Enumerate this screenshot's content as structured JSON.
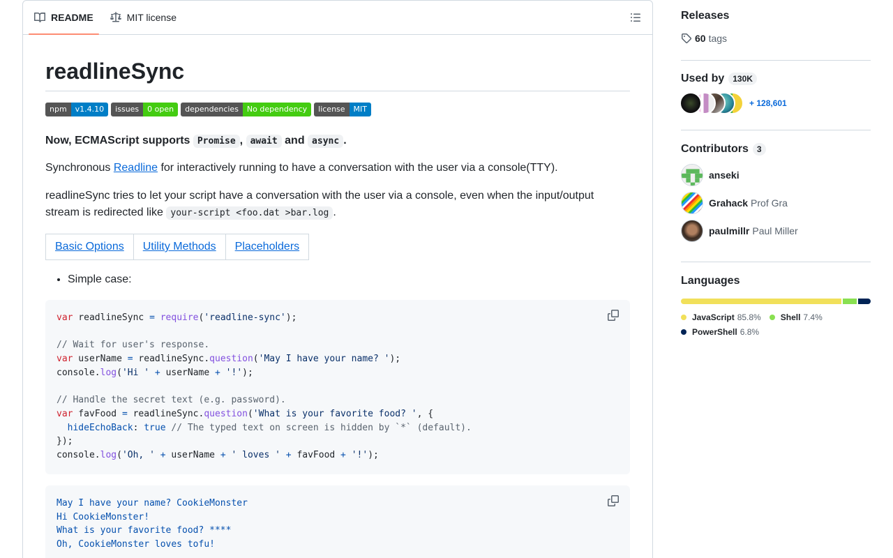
{
  "tabs": {
    "readme": "README",
    "license": "MIT license"
  },
  "readme": {
    "title": "readlineSync",
    "badges": [
      {
        "label": "npm",
        "value": "v1.4.10",
        "color": "#007ec6"
      },
      {
        "label": "issues",
        "value": "0 open",
        "color": "#4c1"
      },
      {
        "label": "dependencies",
        "value": "No dependency",
        "color": "#4c1"
      },
      {
        "label": "license",
        "value": "MIT",
        "color": "#007ec6"
      }
    ],
    "intro": {
      "prefix": "Now, ECMAScript supports ",
      "promise": "Promise",
      "comma": ",",
      "await": "await",
      "and": " and ",
      "async": "async",
      "period": "."
    },
    "p1": {
      "before": "Synchronous ",
      "link": "Readline",
      "after": " for interactively running to have a conversation with the user via a console(TTY)."
    },
    "p2": {
      "before": "readlineSync tries to let your script have a conversation with the user via a console, even when the input/output stream is redirected like ",
      "code": "your-script <foo.dat >bar.log",
      "after": "."
    },
    "nav_links": [
      "Basic Options",
      "Utility Methods",
      "Placeholders"
    ],
    "list_item": "Simple case:",
    "code1": {
      "l1": {
        "kw": "var",
        "a": " readlineSync ",
        "op": "=",
        "sp": " ",
        "fn": "require",
        "p1": "(",
        "str": "'readline-sync'",
        "p2": ");"
      },
      "l3": "// Wait for user's response.",
      "l4": {
        "kw": "var",
        "a": " userName ",
        "op": "=",
        "b": " readlineSync.",
        "fn": "question",
        "p1": "(",
        "str": "'May I have your name? '",
        "p2": ");"
      },
      "l5": {
        "a": "console.",
        "fn": "log",
        "p1": "(",
        "s1": "'Hi '",
        "op1": " + ",
        "v": "userName",
        "op2": " + ",
        "s2": "'!'",
        "p2": ");"
      },
      "l7": "// Handle the secret text (e.g. password).",
      "l8": {
        "kw": "var",
        "a": " favFood ",
        "op": "=",
        "b": " readlineSync.",
        "fn": "question",
        "p1": "(",
        "str": "'What is your favorite food? '",
        "p2": ", {"
      },
      "l9": {
        "ind": "  ",
        "prop": "hideEchoBack",
        "col": ": ",
        "val": "true",
        "cm": " // The typed text on screen is hidden by `*` (default)."
      },
      "l10": "});",
      "l11": {
        "a": "console.",
        "fn": "log",
        "p1": "(",
        "s1": "'Oh, '",
        "op1": " + ",
        "v1": "userName",
        "op2": " + ",
        "s2": "' loves '",
        "op3": " + ",
        "v2": "favFood",
        "op4": " + ",
        "s3": "'!'",
        "p2": ");"
      }
    },
    "code2": [
      "May I have your name? CookieMonster",
      "Hi CookieMonster!",
      "What is your favorite food? ****",
      "Oh, CookieMonster loves tofu!"
    ]
  },
  "sidebar": {
    "releases": {
      "title": "Releases",
      "tag_count": "60",
      "tag_label": "tags"
    },
    "used_by": {
      "title": "Used by",
      "count": "130K",
      "more": "+ 128,601"
    },
    "contributors": {
      "title": "Contributors",
      "count": "3",
      "list": [
        {
          "login": "anseki",
          "name": ""
        },
        {
          "login": "Grahack",
          "name": "Prof Gra"
        },
        {
          "login": "paulmillr",
          "name": "Paul Miller"
        }
      ]
    },
    "languages": {
      "title": "Languages",
      "list": [
        {
          "name": "JavaScript",
          "percent": "85.8%",
          "value": 85.8,
          "color": "#f1e05a"
        },
        {
          "name": "Shell",
          "percent": "7.4%",
          "value": 7.4,
          "color": "#89e051"
        },
        {
          "name": "PowerShell",
          "percent": "6.8%",
          "value": 6.8,
          "color": "#012456"
        }
      ]
    }
  }
}
